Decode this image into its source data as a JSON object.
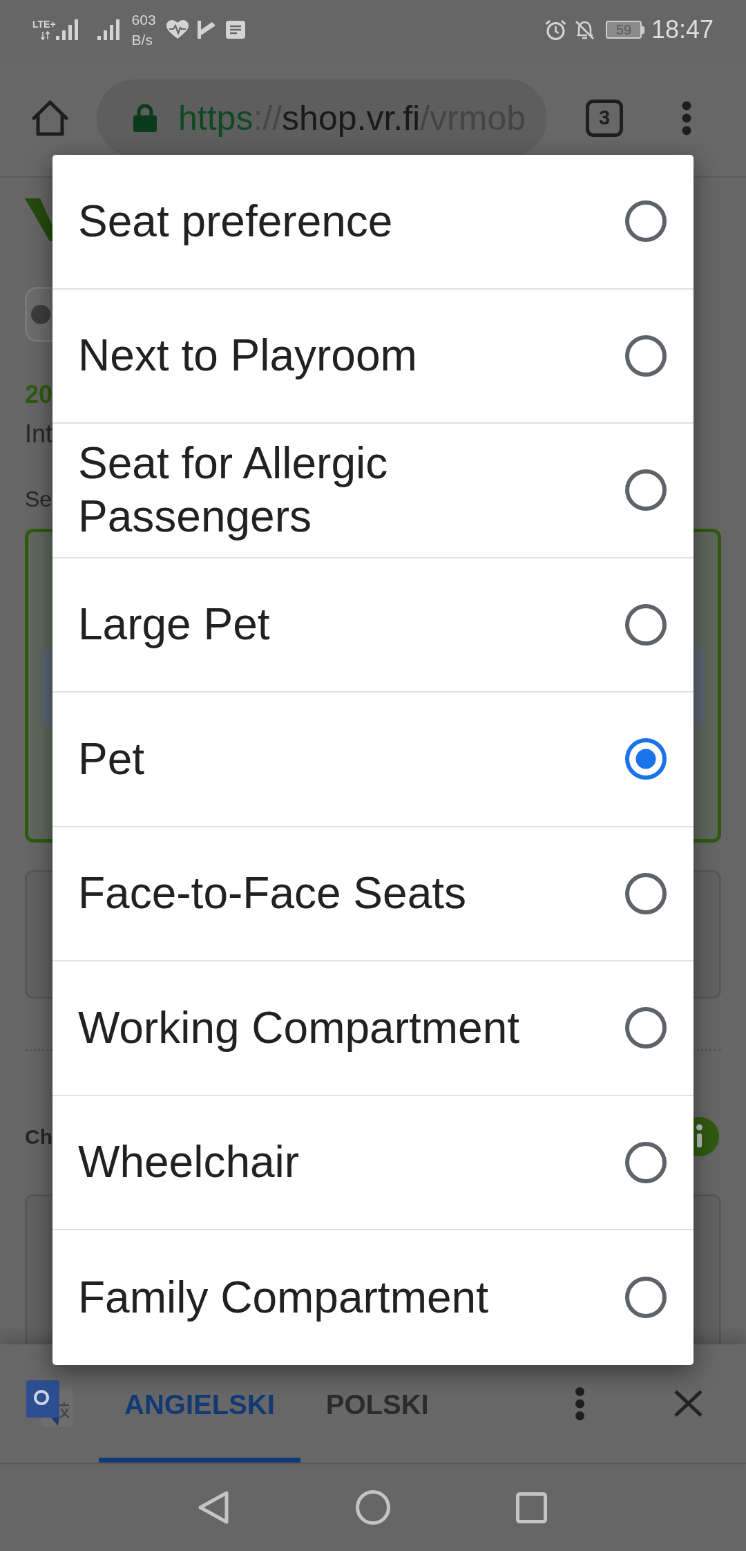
{
  "status_bar": {
    "network_type": "LTE+",
    "speed_value": "603",
    "speed_unit": "B/s",
    "battery": "59",
    "time": "18:47"
  },
  "toolbar": {
    "url": {
      "scheme": "https",
      "separator": "://",
      "host": "shop.vr.fi",
      "path": "/vrmob"
    },
    "tab_count": "3"
  },
  "page": {
    "heading": "20",
    "lines": [
      "Int",
      "Se"
    ],
    "cards": [
      {
        "selected": true
      },
      {
        "selected": false
      }
    ],
    "section": {
      "title": "Ch",
      "cards": [
        {
          "selected": false
        }
      ]
    }
  },
  "dialog": {
    "options": [
      {
        "label": "Seat preference",
        "selected": false
      },
      {
        "label": "Next to Playroom",
        "selected": false
      },
      {
        "label": "Seat for Allergic Passengers",
        "selected": false
      },
      {
        "label": "Large Pet",
        "selected": false
      },
      {
        "label": "Pet",
        "selected": true
      },
      {
        "label": "Face-to-Face Seats",
        "selected": false
      },
      {
        "label": "Working Compartment",
        "selected": false
      },
      {
        "label": "Wheelchair",
        "selected": false
      },
      {
        "label": "Family Compartment",
        "selected": false
      }
    ]
  },
  "translate_bar": {
    "languages": [
      {
        "label": "ANGIELSKI",
        "selected": true
      },
      {
        "label": "POLSKI",
        "selected": false
      }
    ]
  }
}
